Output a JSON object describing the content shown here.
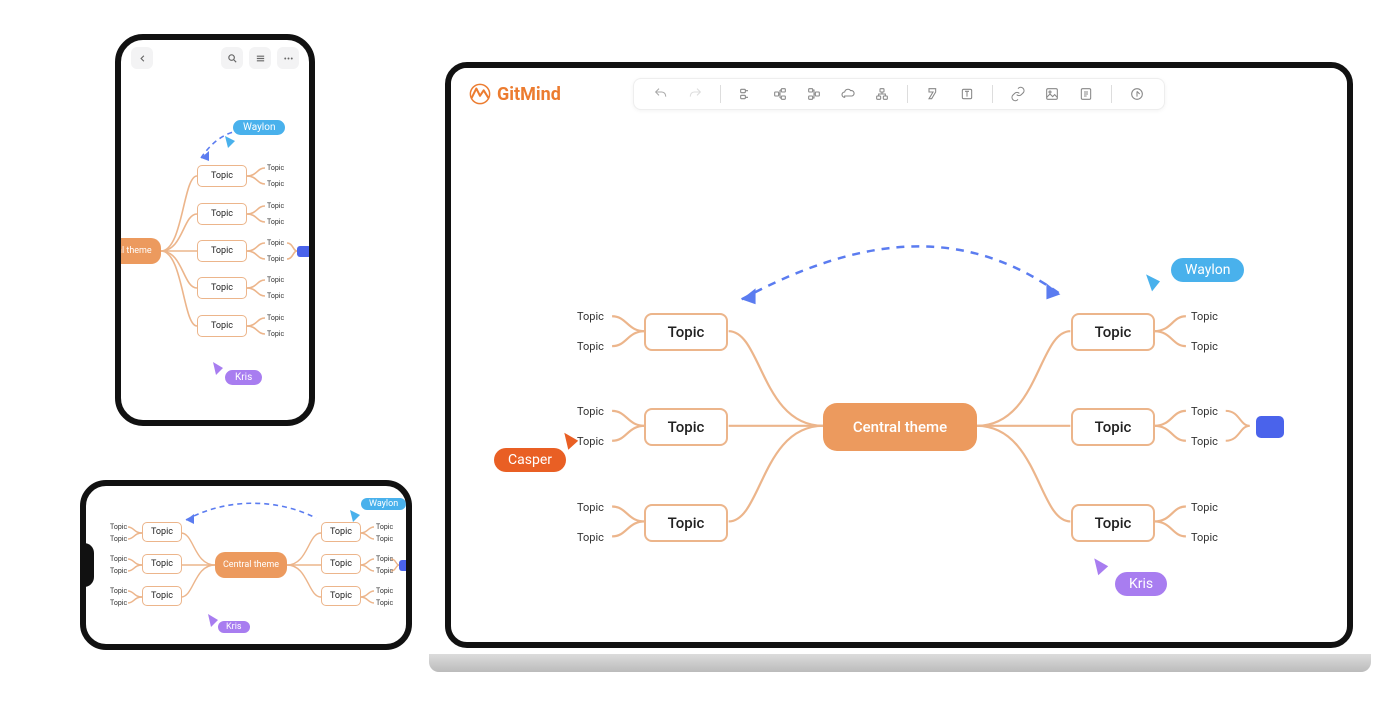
{
  "brand": {
    "name": "GitMind"
  },
  "mindmap": {
    "central": "Central  theme",
    "topic_label": "Topic",
    "leaf_label": "Topic"
  },
  "users": {
    "waylon": "Waylon",
    "kris": "Kris",
    "casper": "Casper"
  },
  "phone_portrait": {
    "central": "ntral theme",
    "topic_label": "Topic",
    "leaf_label": "Topic",
    "users": {
      "waylon": "Waylon",
      "kris": "Kris"
    }
  },
  "phone_landscape": {
    "central": "Central  theme",
    "topic_label": "Topic",
    "leaf_label": "Topic",
    "users": {
      "waylon": "Waylon",
      "kris": "Kris"
    }
  },
  "colors": {
    "brand": "#ec7c30",
    "node_border": "#ecb58b",
    "central": "#ec9a5e",
    "line": "#ecb58b",
    "dashed": "#5b7cf0",
    "waylon": "#49b1ec",
    "kris": "#a87df0",
    "casper": "#e95f24",
    "chip": "#4a63eb"
  }
}
